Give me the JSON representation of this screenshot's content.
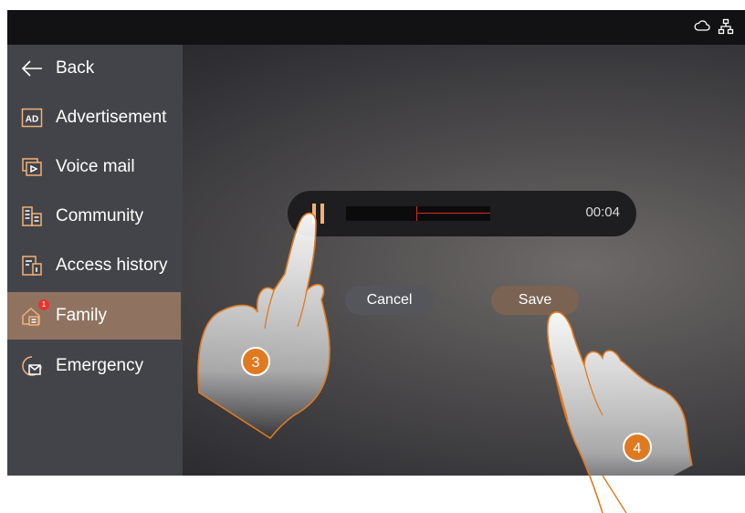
{
  "nav": {
    "items": [
      {
        "label": "Back",
        "icon": "arrow-left-icon"
      },
      {
        "label": "Advertisement",
        "icon": "ad-icon"
      },
      {
        "label": "Voice mail",
        "icon": "voice-mail-icon"
      },
      {
        "label": "Community",
        "icon": "community-icon"
      },
      {
        "label": "Access history",
        "icon": "access-history-icon"
      },
      {
        "label": "Family",
        "icon": "family-icon",
        "active": true,
        "badge": "1"
      },
      {
        "label": "Emergency",
        "icon": "emergency-icon"
      }
    ]
  },
  "status_icons": [
    "cloud-icon",
    "network-icon"
  ],
  "player": {
    "time": "00:04",
    "progress": 0.49,
    "state_icon": "pause-icon"
  },
  "buttons": {
    "cancel": "Cancel",
    "save": "Save"
  },
  "steps": {
    "first": "3",
    "second": "4"
  },
  "colors": {
    "accent": "#f2b178",
    "active_item": "#8f7360",
    "step_badge": "#e07a21",
    "notification": "#e8322e"
  }
}
